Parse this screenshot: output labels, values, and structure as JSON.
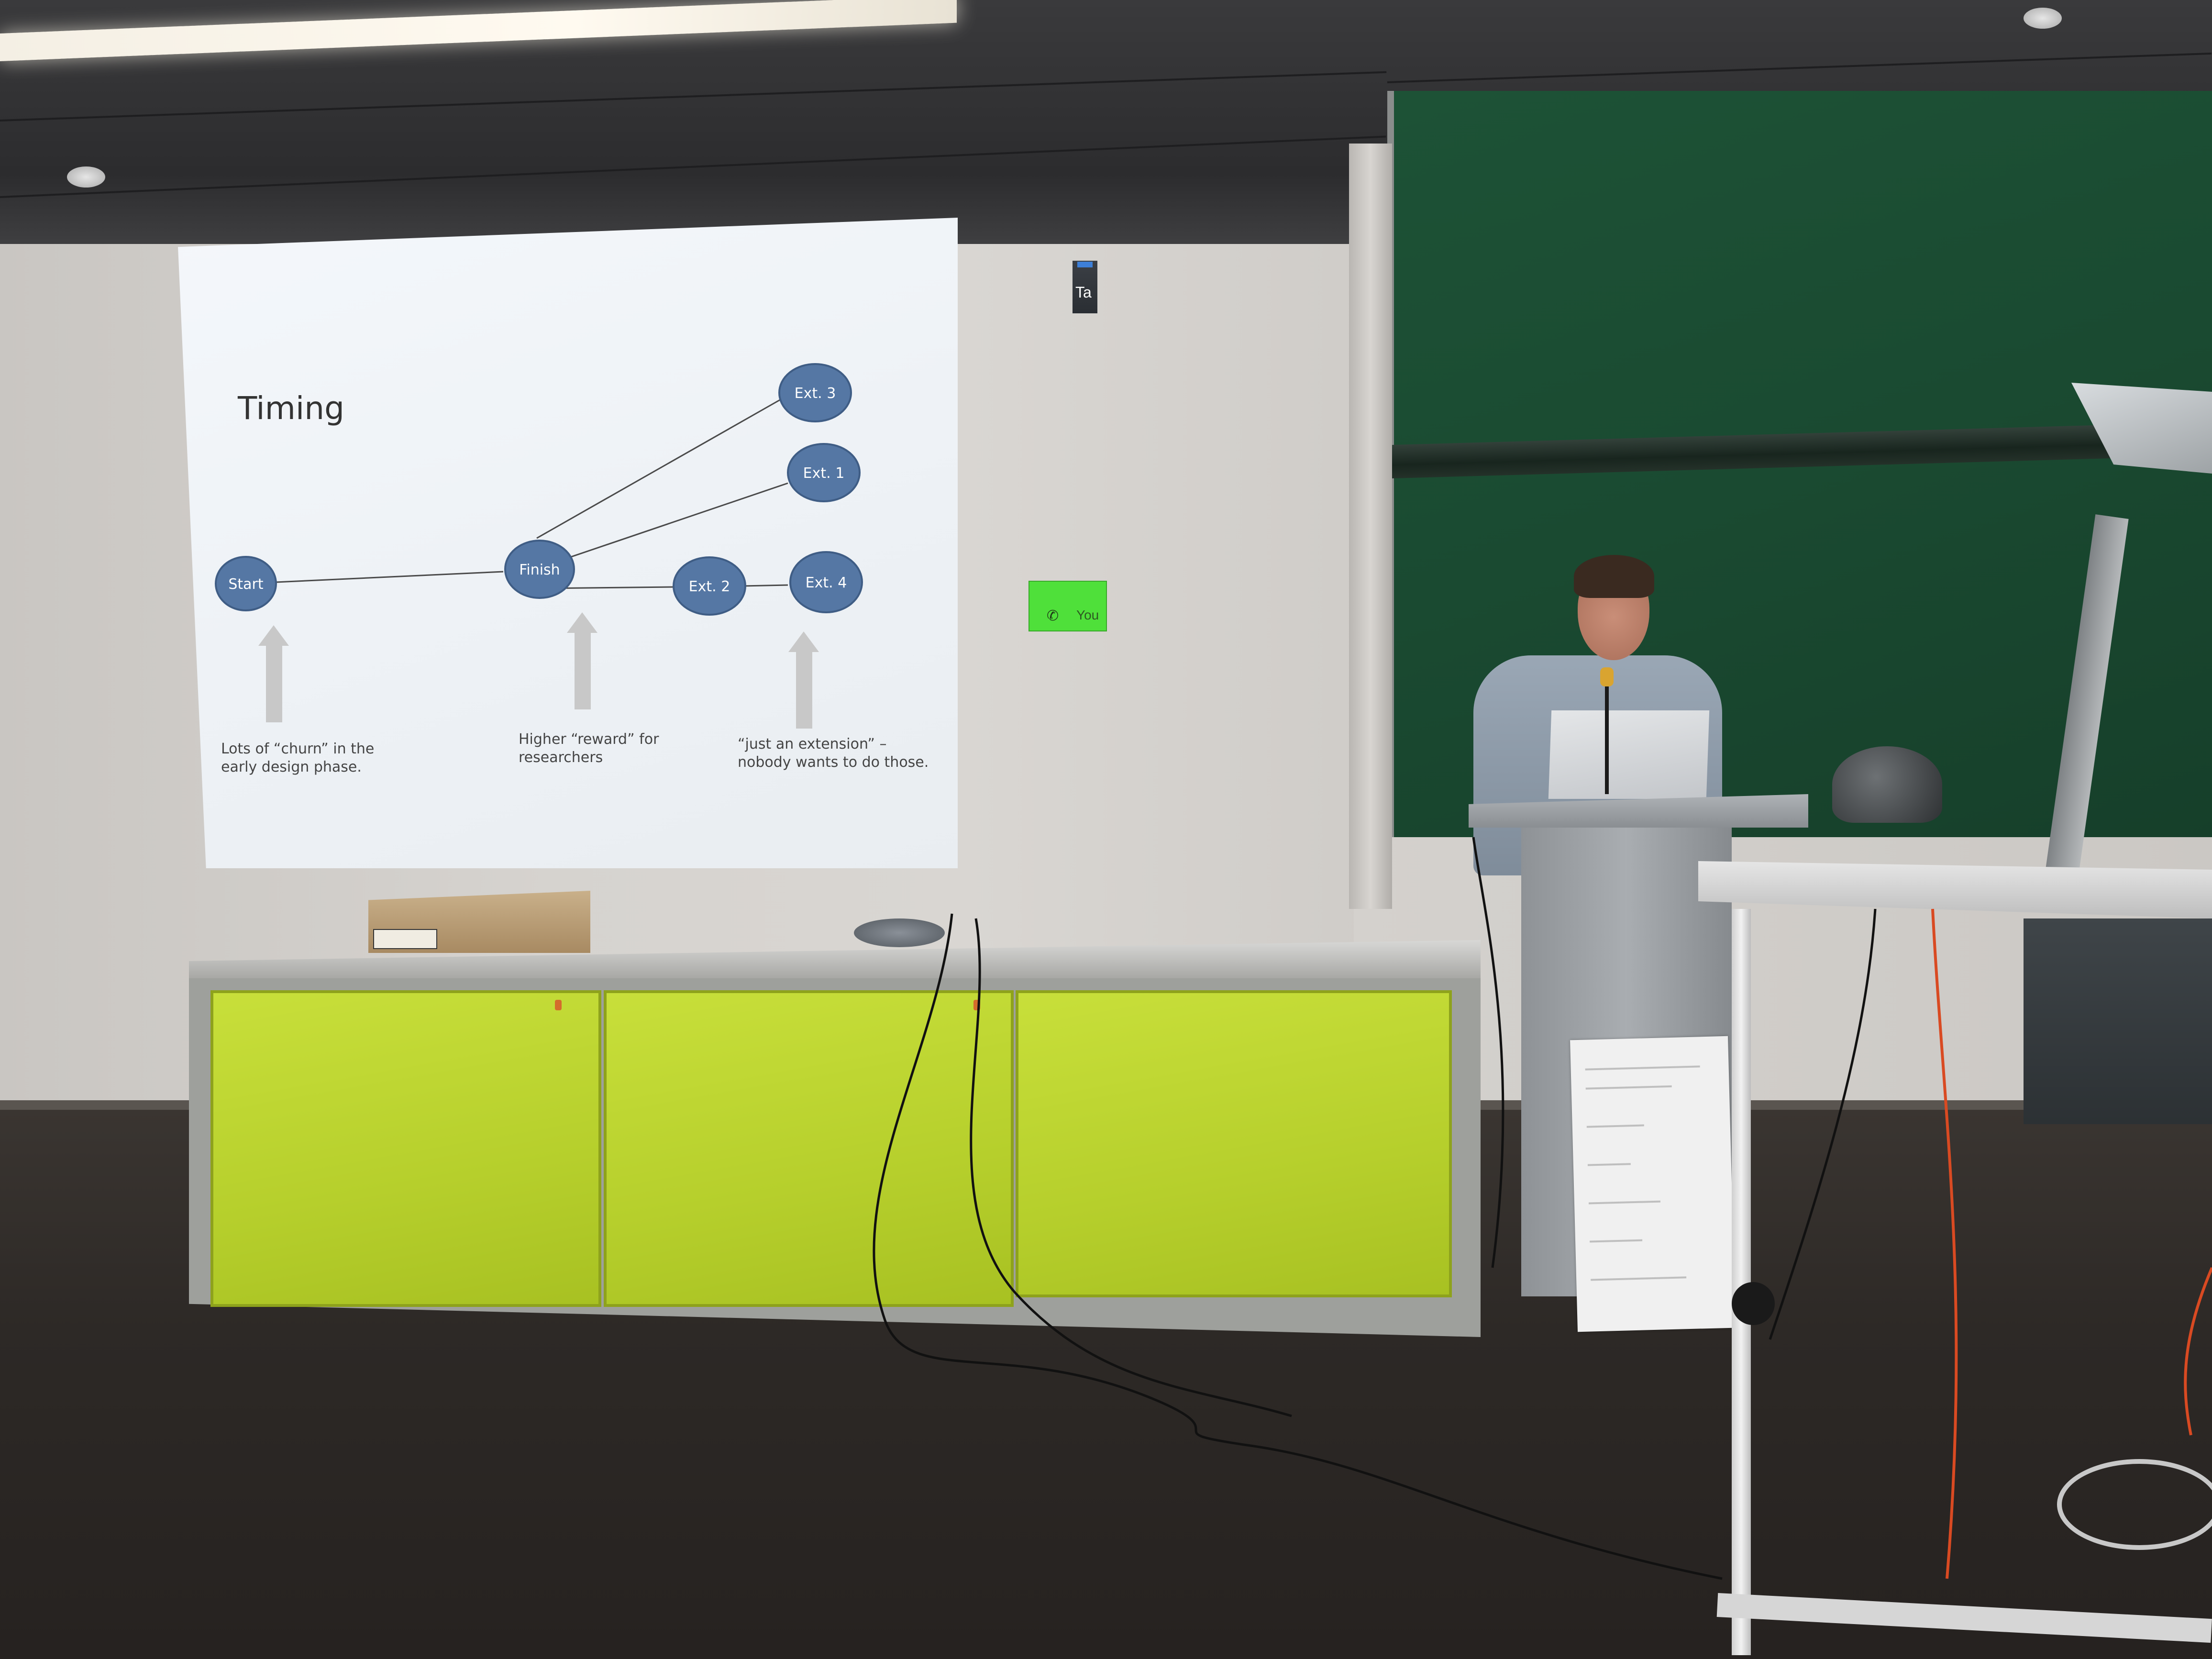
{
  "slide": {
    "title": "Timing",
    "nodes": {
      "start": "Start",
      "finish": "Finish",
      "ext1": "Ext. 1",
      "ext2": "Ext. 2",
      "ext3": "Ext. 3",
      "ext4": "Ext. 4"
    },
    "captions": {
      "start_line1": "Lots of “churn” in the",
      "start_line2": "early design phase.",
      "finish_line1": "Higher “reward” for",
      "finish_line2": "researchers",
      "ext_line1": "“just an extension” –",
      "ext_line2": "nobody wants to do those."
    },
    "colors": {
      "node_fill": "#5577a4",
      "node_stroke": "#3f5d85",
      "arrow": "#c8c8c8",
      "line": "#4a4a4a"
    }
  },
  "overlays": {
    "taskbar_label": "Ta",
    "call_window_text": "You",
    "call_window_color": "#4fe03a"
  },
  "scene": {
    "cabinet_color": "#bcd42f",
    "chalkboard_color": "#1c4e34"
  }
}
